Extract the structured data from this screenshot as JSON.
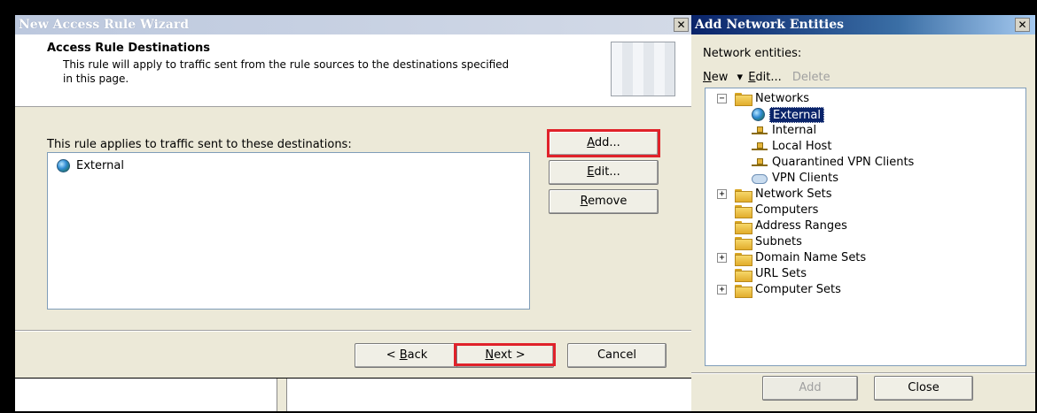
{
  "wizard": {
    "title": "New Access Rule Wizard",
    "close_glyph": "✕",
    "header_title": "Access Rule Destinations",
    "header_desc_line1": "This rule will apply to traffic sent from the rule sources to the destinations specified",
    "header_desc_line2": "in this page.",
    "list_label": "This rule applies to traffic sent to these destinations:",
    "destinations": [
      "External"
    ],
    "add": {
      "pre": "",
      "key": "A",
      "post": "dd..."
    },
    "edit": {
      "pre": "",
      "key": "E",
      "post": "dit..."
    },
    "remove": {
      "pre": "",
      "key": "R",
      "post": "emove"
    },
    "back": {
      "pre": "< ",
      "key": "B",
      "post": "ack"
    },
    "next": {
      "pre": "",
      "key": "N",
      "post": "ext >"
    },
    "cancel": "Cancel"
  },
  "entities": {
    "title": "Add Network Entities",
    "close_glyph": "✕",
    "label": "Network entities:",
    "toolbar": {
      "new_key": "N",
      "new_rest": "ew",
      "arrow": "▾",
      "edit_key": "E",
      "edit_rest": "dit...",
      "delete": "Delete"
    },
    "tree": {
      "networks": "Networks",
      "external": "External",
      "internal": "Internal",
      "local_host": "Local Host",
      "quarantined": "Quarantined VPN Clients",
      "vpn_clients": "VPN Clients",
      "network_sets": "Network Sets",
      "computers": "Computers",
      "address_ranges": "Address Ranges",
      "subnets": "Subnets",
      "domain_name_sets": "Domain Name Sets",
      "url_sets": "URL Sets",
      "computer_sets": "Computer Sets"
    },
    "add_button": "Add",
    "close_button": "Close",
    "expand_plus": "+",
    "expand_minus": "−"
  },
  "colors": {
    "highlight": "#e0222a",
    "title_wizard": "#c6cfe0",
    "title_entities": "#0a246a",
    "selection": "#0a246a"
  }
}
